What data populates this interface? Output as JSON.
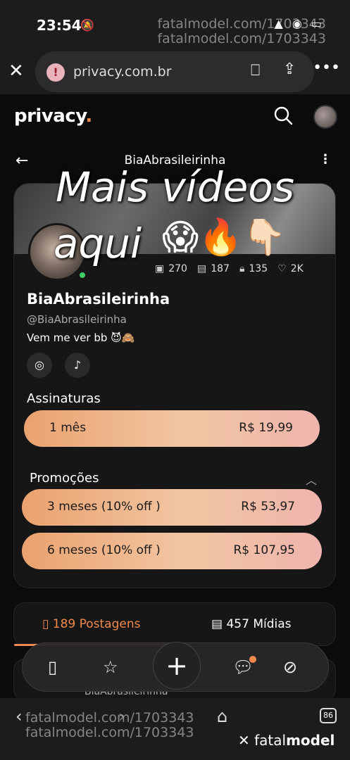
{
  "status": {
    "time": "23:54",
    "icons": "▲ ◉ ▭"
  },
  "watermark": {
    "top_line1": "fatalmodel.com/1703343",
    "top_line2": "fatalmodel.com/1703343",
    "bottom_line1": "fatalmodel.com/1703343",
    "bottom_line2": "fatalmodel.com/1703343",
    "brand_prefix": "fatal",
    "brand_suffix": "model"
  },
  "browser": {
    "url": "privacy.com.br",
    "info_icon": "info-icon"
  },
  "site": {
    "logo_text": "privacy",
    "logo_dot": "."
  },
  "profile": {
    "top_username": "BiaAbrasileirinha",
    "name": "BiaAbrasileirinha",
    "handle": "@BiaAbrasileirinha",
    "bio": "Vem me ver bb 😈🙈",
    "stats": {
      "photos": "270",
      "videos": "187",
      "locked": "135",
      "likes": "2K"
    }
  },
  "overlay": {
    "line1": "Mais vídeos",
    "line2": "aqui",
    "emojis": "😱🔥👇🏻"
  },
  "subscriptions": {
    "title": "Assinaturas",
    "plans": [
      {
        "label": "1 mês",
        "price": "R$ 19,99"
      }
    ]
  },
  "promotions": {
    "title": "Promoções",
    "plans": [
      {
        "label": "3 meses (10% off )",
        "price": "R$ 53,97"
      },
      {
        "label": "6 meses (10% off )",
        "price": "R$ 107,95"
      }
    ]
  },
  "tabs": {
    "posts": "189 Postagens",
    "media": "457 Mídias"
  },
  "post_peek": {
    "name": "BiaAbrasileirinha"
  },
  "bottombar": {
    "tab_count": "86"
  },
  "colors": {
    "accent": "#f08a4b",
    "online": "#3ecf6b"
  }
}
